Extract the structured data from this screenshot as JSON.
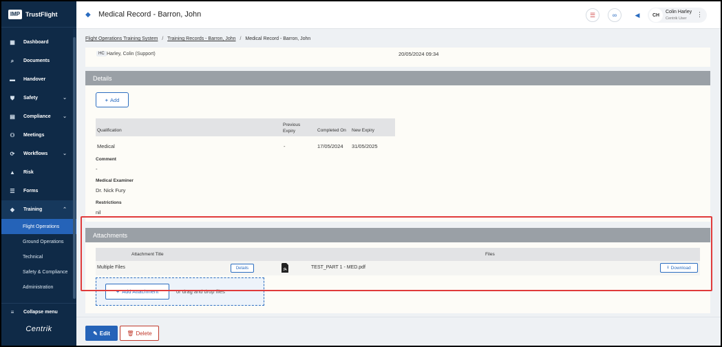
{
  "brand": {
    "badge": "IMP",
    "name": "TrustFlight"
  },
  "sidebar": {
    "items": [
      {
        "label": "Dashboard",
        "icon": "dashboard-icon"
      },
      {
        "label": "Documents",
        "icon": "paperclip-icon"
      },
      {
        "label": "Handover",
        "icon": "handover-icon"
      },
      {
        "label": "Safety",
        "icon": "shield-icon"
      },
      {
        "label": "Compliance",
        "icon": "clipboard-icon"
      },
      {
        "label": "Meetings",
        "icon": "meetings-icon"
      },
      {
        "label": "Workflows",
        "icon": "workflow-icon"
      },
      {
        "label": "Risk",
        "icon": "risk-icon"
      },
      {
        "label": "Forms",
        "icon": "forms-icon"
      },
      {
        "label": "Training",
        "icon": "graduation-cap-icon"
      }
    ],
    "training_sub": [
      "Flight Operations",
      "Ground Operations",
      "Technical",
      "Safety & Compliance",
      "Administration"
    ],
    "collapse_label": "Collapse menu",
    "footer_logo": "Centrik"
  },
  "header": {
    "title": "Medical Record",
    "subtitle": "Barron, John",
    "user": {
      "initials": "CH",
      "name": "Colin Harley",
      "role": "Centrik User"
    }
  },
  "breadcrumb": {
    "items": [
      "Flight Operations Training System",
      "Training Records - Barron, John"
    ],
    "current": "Medical Record - Barron, John",
    "separator": "/"
  },
  "record": {
    "author_initials": "HC",
    "author_name": "Harley, Colin (Support)",
    "date": "20/05/2024 09:34"
  },
  "details": {
    "heading": "Details",
    "add_label": "Add",
    "columns": {
      "qualification": "Qualification",
      "previous": "Previous Expiry",
      "completed": "Completed On",
      "new": "New Expiry"
    },
    "rows": [
      {
        "qualification": "Medical",
        "previous": "-",
        "completed": "17/05/2024",
        "new": "31/05/2025"
      }
    ],
    "comment_label": "Comment",
    "comment_value": "-",
    "examiner_label": "Medical Examiner",
    "examiner_value": "Dr. Nick Fury",
    "restrictions_label": "Restrictions",
    "restrictions_value": "nil"
  },
  "attachments": {
    "heading": "Attachments",
    "col_title": "Attachment Title",
    "col_files": "Files",
    "rows": [
      {
        "title": "Multiple Files",
        "details_label": "Details",
        "file": "TEST_PART 1 - MED.pdf",
        "download_label": "Download"
      }
    ],
    "add_label": "Add Attachment",
    "drag_text": "or drag and drop files"
  },
  "actions": {
    "edit": "Edit",
    "delete": "Delete"
  },
  "colors": {
    "sidebar": "#0f2a47",
    "accent": "#2563b8",
    "danger": "#c0392b",
    "highlight": "#e03a3a"
  }
}
